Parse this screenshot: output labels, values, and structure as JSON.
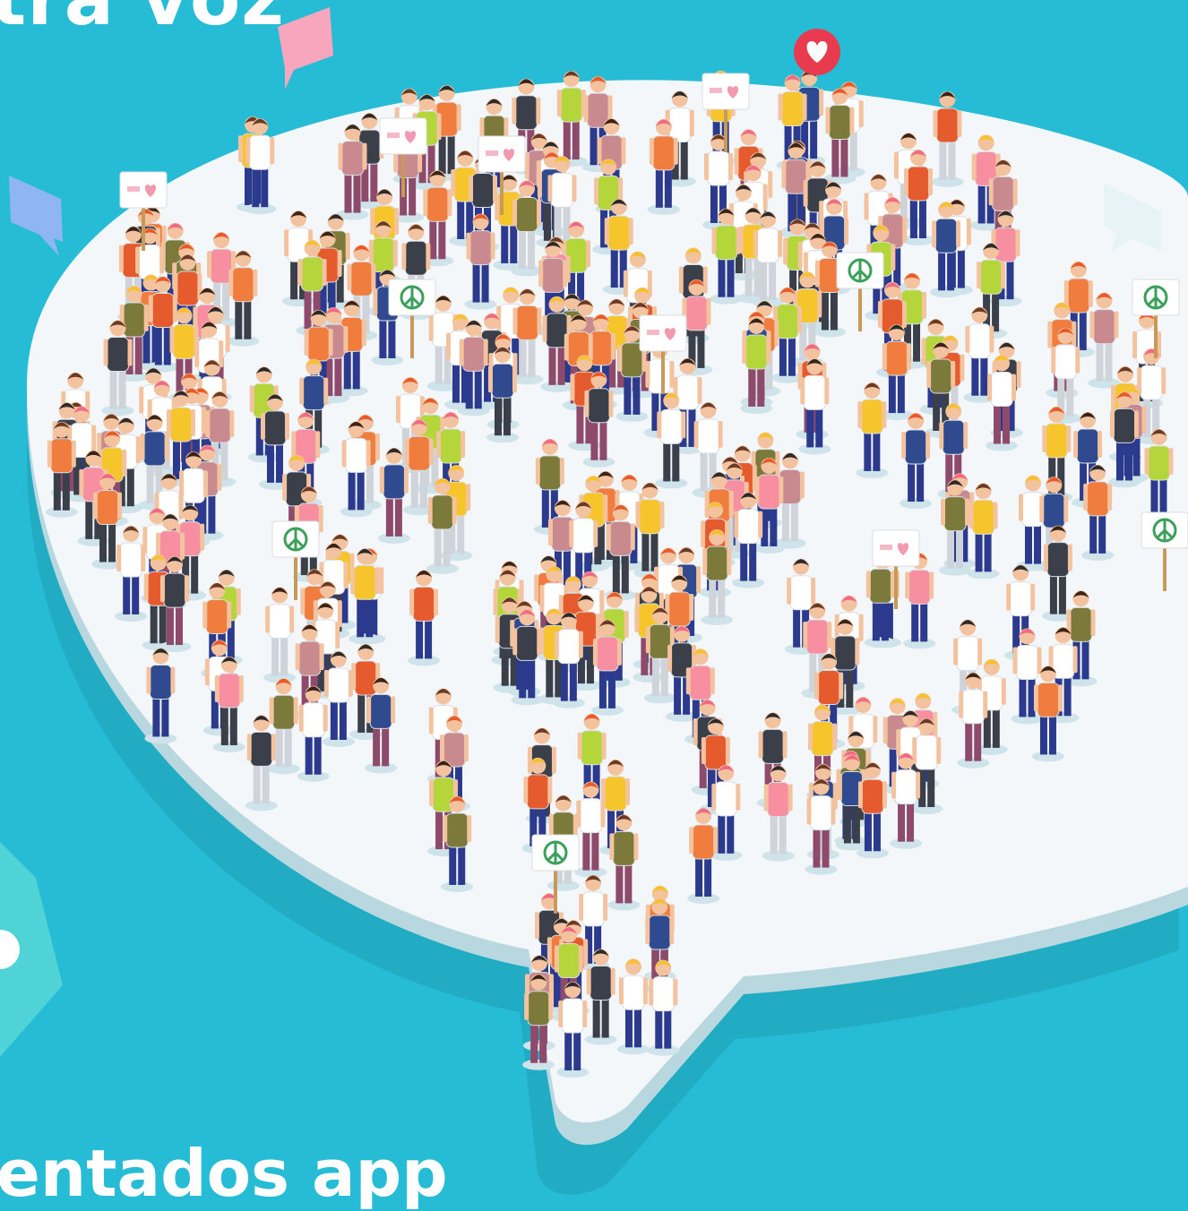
{
  "headline": "tra voz",
  "footer": "entados app",
  "colors": {
    "background": "#27bcd6",
    "platform_top": "#f4f7f9",
    "platform_side": "#b9d7df",
    "shadow": "#1d9fb6",
    "text": "#ffffff"
  },
  "icons": [
    "chat-bubble-pink-icon",
    "heart-notification-icon",
    "chat-bubble-blue-icon",
    "chat-bubble-white-icon",
    "peace-sign-icon",
    "we-love-sign-icon"
  ]
}
